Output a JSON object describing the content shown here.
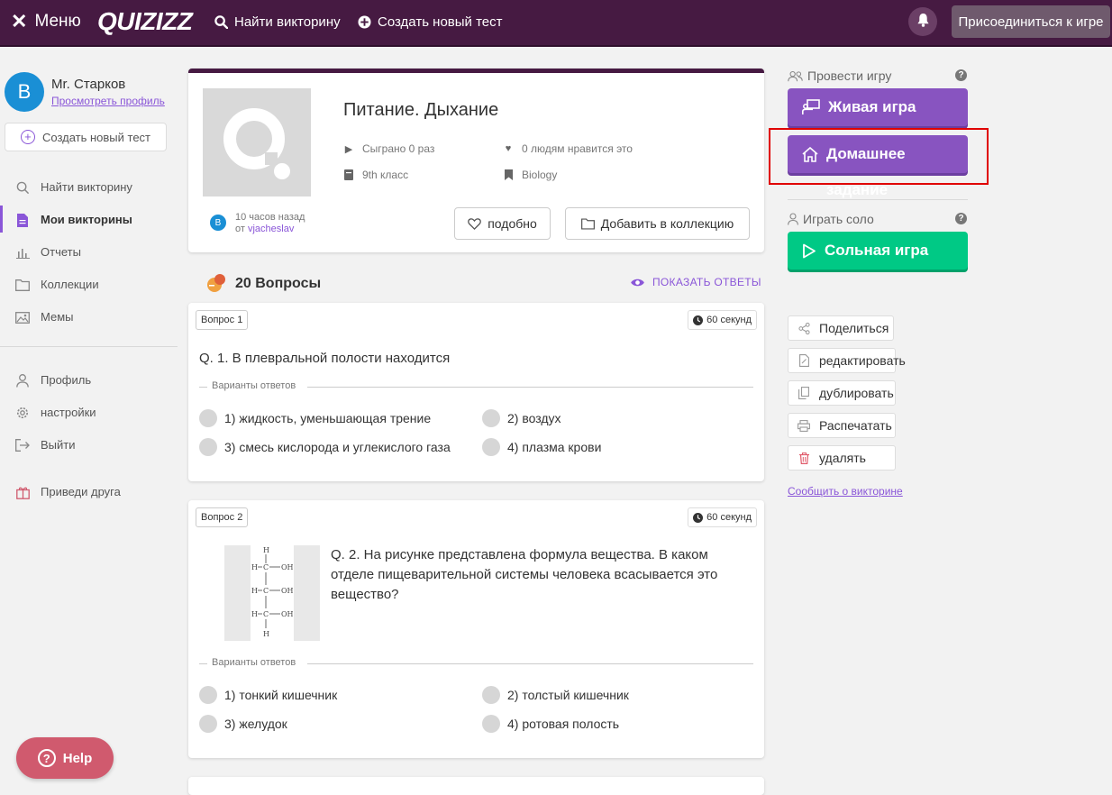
{
  "topbar": {
    "menu_label": "Меню",
    "logo": "QUIZIZZ",
    "find_quiz": "Найти викторину",
    "create_test": "Создать новый тест",
    "join_game": "Присоединиться к игре"
  },
  "user": {
    "initial": "B",
    "name": "Mr. Старков",
    "view_profile": "Просмотреть профиль",
    "new_test": "Создать новый тест"
  },
  "sidebar": {
    "items": [
      {
        "label": "Найти викторину",
        "icon": "search-icon"
      },
      {
        "label": "Мои викторины",
        "icon": "document-icon"
      },
      {
        "label": "Отчеты",
        "icon": "bar-chart-icon"
      },
      {
        "label": "Коллекции",
        "icon": "folder-icon"
      },
      {
        "label": "Мемы",
        "icon": "image-icon"
      },
      {
        "label": "Профиль",
        "icon": "user-icon"
      },
      {
        "label": "настройки",
        "icon": "gear-icon"
      },
      {
        "label": "Выйти",
        "icon": "logout-icon"
      },
      {
        "label": "Приведи друга",
        "icon": "gift-icon"
      }
    ],
    "help": "Help"
  },
  "quiz": {
    "title": "Питание. Дыхание",
    "played": "Сыграно 0 раз",
    "likes": "0 людям нравится это",
    "grade": "9th класс",
    "subject": "Biology",
    "author_initial": "B",
    "time_ago": "10 часов назад",
    "by": "от",
    "author": "vjacheslav",
    "like_btn": "подобно",
    "add_collection_btn": "Добавить в коллекцию"
  },
  "questions_header": {
    "count": "20 Вопросы",
    "show_answers": "ПОКАЗАТЬ ОТВЕТЫ"
  },
  "questions": [
    {
      "tag": "Вопрос 1",
      "time": "60 секунд",
      "text": "Q. 1. В плевральной полости находится",
      "options_label": "Варианты ответов",
      "options": [
        "1) жидкость, уменьшающая трение",
        "2) воздух",
        "3) смесь кислорода и углекислого газа",
        "4) плазма крови"
      ]
    },
    {
      "tag": "Вопрос 2",
      "time": "60 секунд",
      "text": "Q. 2. На рисунке представлена формула вещества. В каком отделе пищеварительной системы человека всасывается это вещество?",
      "options_label": "Варианты ответов",
      "options": [
        "1) тонкий кишечник",
        "2) толстый кишечник",
        "3) желудок",
        "4) ротовая полость"
      ]
    }
  ],
  "right_panel": {
    "host_game": "Провести игру",
    "live_game": "Живая игра",
    "homework_line1": "Домашнее",
    "homework_line2": "задание",
    "play_solo": "Играть соло",
    "solo_game": "Сольная игра",
    "actions": [
      "Поделиться",
      "редактировать",
      "дублировать",
      "Распечатать",
      "удалять"
    ],
    "report": "Сообщить о викторине"
  },
  "colors": {
    "topbar": "#461a42",
    "accent": "#8854c0",
    "solo": "#00c985",
    "highlight": "#e00000",
    "help": "#d05a6e"
  }
}
